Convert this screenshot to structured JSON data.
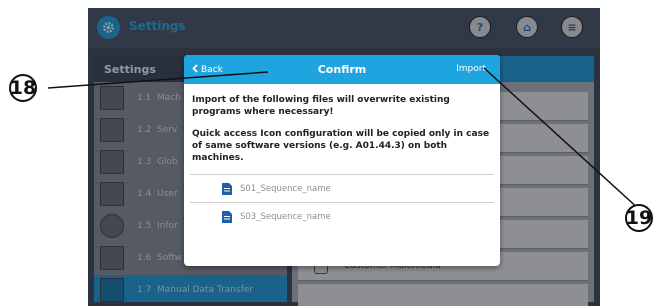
{
  "app": {
    "title": "Settings"
  },
  "topbar_buttons": [
    {
      "name": "help-button",
      "glyph": "?"
    },
    {
      "name": "home-button",
      "glyph": "⌂"
    },
    {
      "name": "menu-button",
      "glyph": "≡"
    }
  ],
  "sidebar": {
    "title": "Settings",
    "items": [
      {
        "num": "1.1",
        "label": "Mach",
        "icon": "gears-icon"
      },
      {
        "num": "1.2",
        "label": "Serv",
        "icon": "service-icon"
      },
      {
        "num": "1.3",
        "label": "Glob",
        "icon": "gp-icon"
      },
      {
        "num": "1.4",
        "label": "User",
        "icon": "users-icon"
      },
      {
        "num": "1.5",
        "label": "Infor",
        "icon": "info-icon"
      },
      {
        "num": "1.6",
        "label": "Softw",
        "icon": "software-icon"
      },
      {
        "num": "1.7",
        "label": "Manual Data Transfer",
        "icon": "data-transfer-icon",
        "active": true
      }
    ]
  },
  "main": {
    "rows": [
      {
        "label": "Customer Multimedia"
      }
    ]
  },
  "dialog": {
    "back_label": "Back",
    "title": "Confirm",
    "import_label": "Import",
    "message1": "Import of the following files will overwrite existing programs where necessary!",
    "message2": "Quick access Icon configuration will be copied only in case of same software versions (e.g. A01.44.3) on both machines.",
    "files": [
      "S01_Sequence_name",
      "S03_Sequence_name"
    ]
  },
  "callouts": {
    "left": "18",
    "right": "19"
  },
  "colors": {
    "accent": "#1ea5e0",
    "background": "#3f4a58"
  }
}
